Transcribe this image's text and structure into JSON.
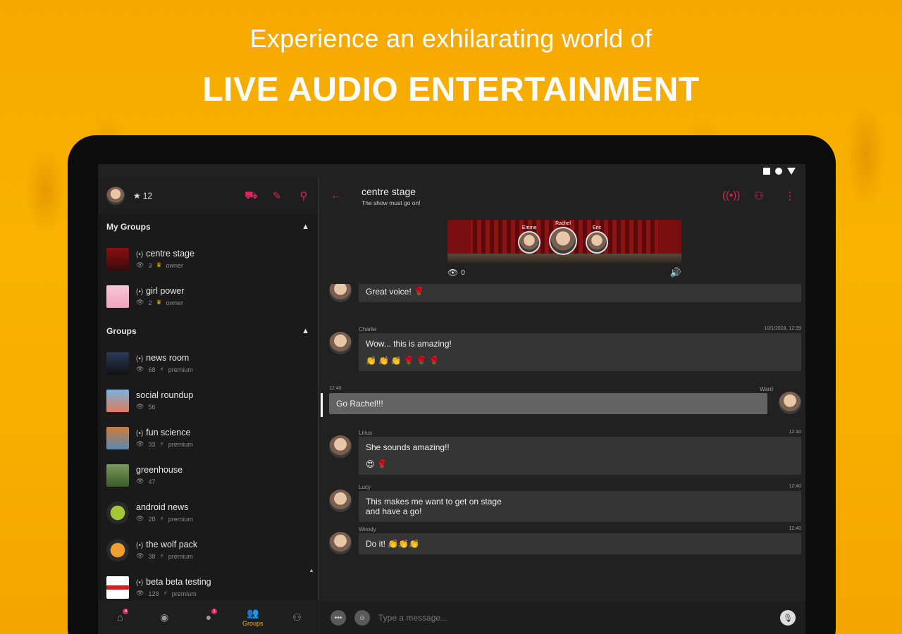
{
  "promo": {
    "line1": "Experience an exhilarating world of",
    "line2": "LIVE AUDIO ENTERTAINMENT"
  },
  "colors": {
    "accent": "#e0245e",
    "gold": "#f5b400",
    "background": "#212121"
  },
  "profile": {
    "stars": "12"
  },
  "my_groups": {
    "title": "My Groups",
    "items": [
      {
        "name": "centre stage",
        "members": "3",
        "role": "owner"
      },
      {
        "name": "girl power",
        "members": "2",
        "role": "owner"
      }
    ]
  },
  "groups": {
    "title": "Groups",
    "items": [
      {
        "name": "news room",
        "members": "68",
        "tag": "premium"
      },
      {
        "name": "social roundup",
        "members": "56",
        "tag": ""
      },
      {
        "name": "fun science",
        "members": "33",
        "tag": "premium"
      },
      {
        "name": "greenhouse",
        "members": "47",
        "tag": ""
      },
      {
        "name": "android news",
        "members": "28",
        "tag": "premium"
      },
      {
        "name": "the wolf pack",
        "members": "38",
        "tag": "premium"
      },
      {
        "name": "beta beta testing",
        "members": "128",
        "tag": "premium"
      }
    ]
  },
  "bottom_nav": {
    "active_label": "Groups",
    "home_badge": "4",
    "chats_badge": "1"
  },
  "chat": {
    "title": "centre stage",
    "subtitle": "The show must go on!",
    "stage_members": [
      "Emma",
      "Rachel",
      "Eric"
    ],
    "listeners": "0",
    "messages": [
      {
        "sender": "",
        "time": "",
        "text": "Great voice! 🌹",
        "emojis": ""
      },
      {
        "sender": "Charlie",
        "time": "10/1/2018, 12:39",
        "text": "Wow... this is amazing!",
        "emojis": "👏👏👏🌹🌹🌹"
      },
      {
        "sender": "Ward",
        "time": "12:40",
        "text": "Go Rachel!!!",
        "emojis": ""
      },
      {
        "sender": "Linus",
        "time": "12:40",
        "text": "She sounds amazing!!",
        "emojis": "😍🌹"
      },
      {
        "sender": "Lucy",
        "time": "12:40",
        "text": "This makes me want to get on stage and have a go!",
        "emojis": ""
      },
      {
        "sender": "Woody",
        "time": "12:40",
        "text": "Do it! 👏👏👏",
        "emojis": ""
      }
    ],
    "composer_placeholder": "Type a message..."
  }
}
